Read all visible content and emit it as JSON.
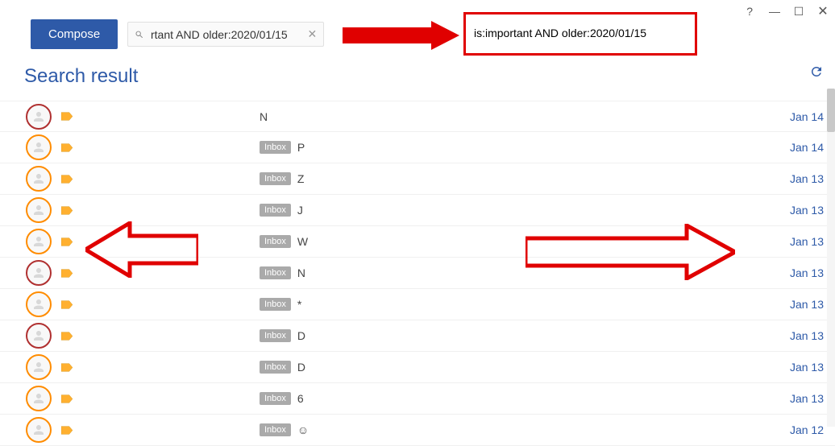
{
  "window_controls": {
    "help": "?"
  },
  "toolbar": {
    "compose_label": "Compose",
    "search_value": "rtant AND older:2020/01/15"
  },
  "annotation": {
    "text": "is:important AND older:2020/01/15"
  },
  "heading": "Search result",
  "inbox_badge_label": "Inbox",
  "rows": [
    {
      "avatar": "red",
      "badge": false,
      "subject": "N",
      "date": "Jan 14"
    },
    {
      "avatar": "orange",
      "badge": true,
      "subject": "P",
      "date": "Jan 14"
    },
    {
      "avatar": "orange",
      "badge": true,
      "subject": "Z",
      "date": "Jan 13"
    },
    {
      "avatar": "orange",
      "badge": true,
      "subject": "J",
      "date": "Jan 13"
    },
    {
      "avatar": "orange",
      "badge": true,
      "subject": "W",
      "date": "Jan 13"
    },
    {
      "avatar": "red",
      "badge": true,
      "subject": "N",
      "date": "Jan 13"
    },
    {
      "avatar": "orange",
      "badge": true,
      "subject": "*",
      "date": "Jan 13"
    },
    {
      "avatar": "red",
      "badge": true,
      "subject": "D",
      "date": "Jan 13"
    },
    {
      "avatar": "orange",
      "badge": true,
      "subject": "D",
      "date": "Jan 13"
    },
    {
      "avatar": "orange",
      "badge": true,
      "subject": "6",
      "date": "Jan 13"
    },
    {
      "avatar": "orange",
      "badge": true,
      "subject": "☺",
      "date": "Jan 12"
    }
  ]
}
